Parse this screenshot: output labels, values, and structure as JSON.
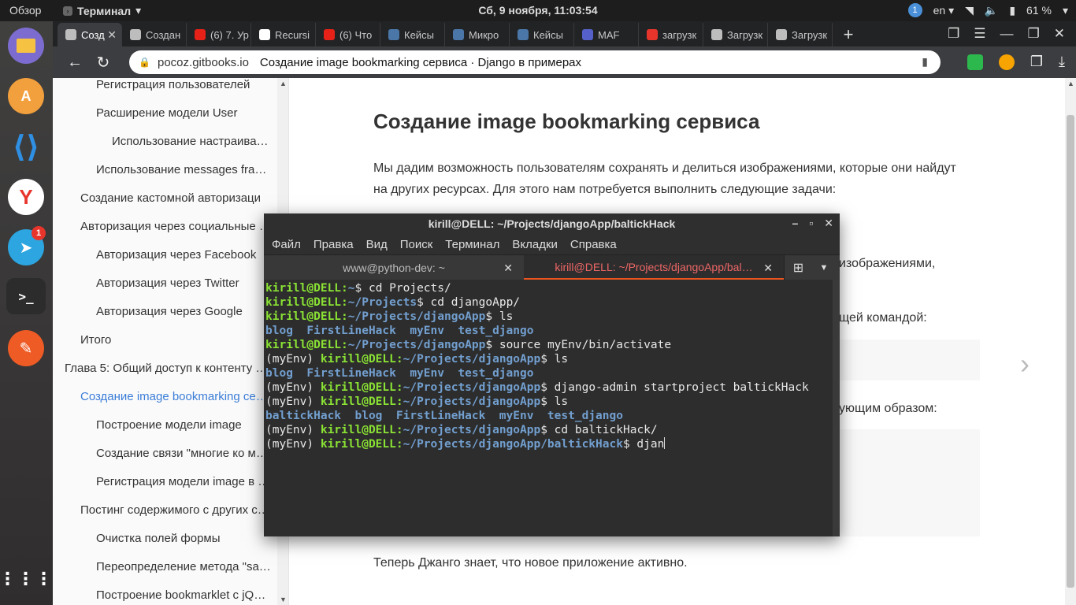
{
  "topbar": {
    "activities": "Обзор",
    "app_menu": "Терминал",
    "clock": "Сб, 9 ноября, 11:03:54",
    "notif_count": "1",
    "lang": "en",
    "battery": "61 %"
  },
  "dock": {
    "telegram_badge": "1"
  },
  "browser": {
    "tabs": [
      {
        "label": "Созд",
        "active": true,
        "color": "#bdbdbd"
      },
      {
        "label": "Создан",
        "active": false,
        "color": "#bdbdbd"
      },
      {
        "label": "(6) 7. Ур",
        "active": false,
        "color": "#e62117"
      },
      {
        "label": "Recursi",
        "active": false,
        "color": "#ffffff"
      },
      {
        "label": "(6) Что",
        "active": false,
        "color": "#e62117"
      },
      {
        "label": "Кейсы",
        "active": false,
        "color": "#4a76a8"
      },
      {
        "label": "Микро",
        "active": false,
        "color": "#4a76a8"
      },
      {
        "label": "Кейсы",
        "active": false,
        "color": "#4a76a8"
      },
      {
        "label": "MAF",
        "active": false,
        "color": "#5561c9"
      },
      {
        "label": "загрузк",
        "active": false,
        "color": "#e8352c"
      },
      {
        "label": "Загрузк",
        "active": false,
        "color": "#bdbdbd"
      },
      {
        "label": "Загрузк",
        "active": false,
        "color": "#bdbdbd"
      }
    ],
    "url_domain": "pocoz.gitbooks.io",
    "url_title": "Создание image bookmarking сервиса · Django в примерах"
  },
  "sidebar": {
    "items": [
      {
        "label": "Регистрация пользователей",
        "level": 2,
        "active": false
      },
      {
        "label": "Расширение модели User",
        "level": 2,
        "active": false
      },
      {
        "label": "Использование настраива…",
        "level": 3,
        "active": false
      },
      {
        "label": "Использование messages fra…",
        "level": 2,
        "active": false
      },
      {
        "label": "Создание кастомной авторизаци",
        "level": 1,
        "active": false
      },
      {
        "label": "Авторизация через социальные …",
        "level": 1,
        "active": false
      },
      {
        "label": "Авторизация через Facebook",
        "level": 2,
        "active": false
      },
      {
        "label": "Авторизация через Twitter",
        "level": 2,
        "active": false
      },
      {
        "label": "Авторизация через Google",
        "level": 2,
        "active": false
      },
      {
        "label": "Итого",
        "level": 1,
        "active": false
      },
      {
        "label": "Глава 5: Общий доступ к контенту …",
        "level": 0,
        "active": false
      },
      {
        "label": "Создание image bookmarking се…",
        "level": 1,
        "active": true
      },
      {
        "label": "Построение модели image",
        "level": 2,
        "active": false
      },
      {
        "label": "Создание связи \"многие ко м…",
        "level": 2,
        "active": false
      },
      {
        "label": "Регистрация модели image в …",
        "level": 2,
        "active": false
      },
      {
        "label": "Постинг содержимого с других с…",
        "level": 1,
        "active": false
      },
      {
        "label": "Очистка полей формы",
        "level": 2,
        "active": false
      },
      {
        "label": "Переопределение метода \"sa…",
        "level": 2,
        "active": false
      },
      {
        "label": "Построение bookmarklet с jQ…",
        "level": 2,
        "active": false
      }
    ]
  },
  "page": {
    "title": "Создание image bookmarking сервиса",
    "intro_line1": "Мы дадим возможность пользователям сохранять и делиться изображениями, которые они найдут",
    "intro_line2": "на других ресурсах. Для этого нам потребуется выполнить следующие задачи:",
    "partial1": "изображениями,",
    "partial2": "щей командой:",
    "partial3": "ующим образом:",
    "footer_text": "Теперь Джанго знает, что новое приложение активно."
  },
  "terminal": {
    "title": "kirill@DELL: ~/Projects/djangoApp/baltickHack",
    "menu": [
      "Файл",
      "Правка",
      "Вид",
      "Поиск",
      "Терминал",
      "Вкладки",
      "Справка"
    ],
    "tab1": "www@python-dev: ~",
    "tab2": "kirill@DELL: ~/Projects/djangoApp/bal…",
    "lines": [
      {
        "env": "",
        "user": "kirill@DELL",
        "path": "~",
        "cmd": " cd Projects/"
      },
      {
        "env": "",
        "user": "kirill@DELL",
        "path": "~/Projects",
        "cmd": " cd djangoApp/"
      },
      {
        "env": "",
        "user": "kirill@DELL",
        "path": "~/Projects/djangoApp",
        "cmd": " ls"
      },
      {
        "dirs": "blog  FirstLineHack  myEnv  test_django"
      },
      {
        "env": "",
        "user": "kirill@DELL",
        "path": "~/Projects/djangoApp",
        "cmd": " source myEnv/bin/activate"
      },
      {
        "env": "(myEnv) ",
        "user": "kirill@DELL",
        "path": "~/Projects/djangoApp",
        "cmd": " ls"
      },
      {
        "dirs": "blog  FirstLineHack  myEnv  test_django"
      },
      {
        "env": "(myEnv) ",
        "user": "kirill@DELL",
        "path": "~/Projects/djangoApp",
        "cmd": " django-admin startproject baltickHack"
      },
      {
        "env": "(myEnv) ",
        "user": "kirill@DELL",
        "path": "~/Projects/djangoApp",
        "cmd": " ls"
      },
      {
        "dirs": "baltickHack  blog  FirstLineHack  myEnv  test_django"
      },
      {
        "env": "(myEnv) ",
        "user": "kirill@DELL",
        "path": "~/Projects/djangoApp",
        "cmd": " cd baltickHack/"
      },
      {
        "env": "(myEnv) ",
        "user": "kirill@DELL",
        "path": "~/Projects/djangoApp/baltickHack",
        "cmd": " djan"
      }
    ]
  },
  "colors": {
    "ubuntu_orange": "#e95420",
    "link_blue": "#3b7dd8",
    "prompt_green": "#8ae234",
    "path_blue": "#729fcf"
  }
}
